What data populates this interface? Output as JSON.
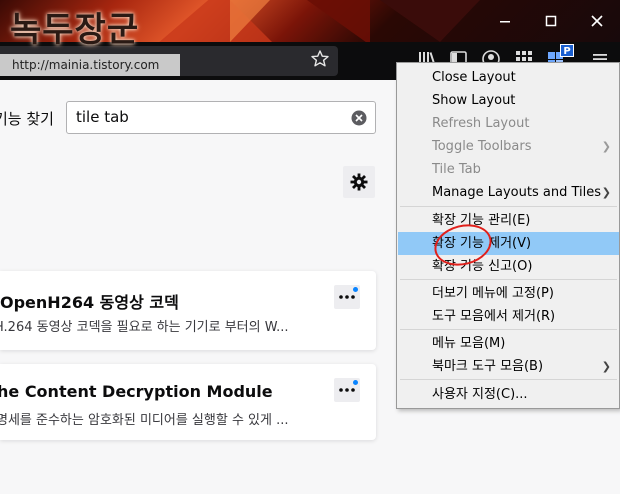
{
  "watermark": {
    "title": "녹두장군",
    "url": "http://mainia.tistory.com"
  },
  "toolbar": {
    "badge_letter": "P",
    "icons": [
      "library-icon",
      "sidebar-icon",
      "account-icon",
      "extensions-grid-icon",
      "tile-tabs-icon",
      "hamburger-menu-icon"
    ]
  },
  "content": {
    "search_label": "기능 찾기",
    "search_value": "tile tab",
    "addons": [
      {
        "title": "OpenH264 동영상 코덱",
        "description": "H.264 동영상 코덱을 필요로 하는 기기로 부터의 W..."
      },
      {
        "title": "he Content Decryption Module",
        "description": "명세를 준수하는 암호화된 미디어를 실행할 수 있게 ..."
      }
    ]
  },
  "menu": {
    "items": [
      {
        "label": "Close Layout",
        "disabled": false,
        "submenu": false
      },
      {
        "label": "Show Layout",
        "disabled": false,
        "submenu": false
      },
      {
        "label": "Refresh Layout",
        "disabled": true,
        "submenu": false
      },
      {
        "label": "Toggle Toolbars",
        "disabled": true,
        "submenu": true
      },
      {
        "label": "Tile Tab",
        "disabled": true,
        "submenu": false
      },
      {
        "label": "Manage Layouts and Tiles",
        "disabled": false,
        "submenu": true
      },
      {
        "label": "확장 기능 관리(E)",
        "disabled": false,
        "submenu": false
      },
      {
        "label": "확장 기능 제거(V)",
        "disabled": false,
        "submenu": false,
        "highlighted": true
      },
      {
        "label": "확장 기능 신고(O)",
        "disabled": false,
        "submenu": false
      },
      {
        "label": "더보기 메뉴에 고정(P)",
        "disabled": false,
        "submenu": false
      },
      {
        "label": "도구 모음에서 제거(R)",
        "disabled": false,
        "submenu": false
      },
      {
        "label": "메뉴 모음(M)",
        "disabled": false,
        "submenu": false
      },
      {
        "label": "북마크 도구 모음(B)",
        "disabled": false,
        "submenu": true
      },
      {
        "label": "사용자 지정(C)...",
        "disabled": false,
        "submenu": false
      }
    ]
  },
  "colors": {
    "menu_highlight": "#91c9f7",
    "annotation": "#e0201b",
    "badge": "#1a5fd0"
  }
}
